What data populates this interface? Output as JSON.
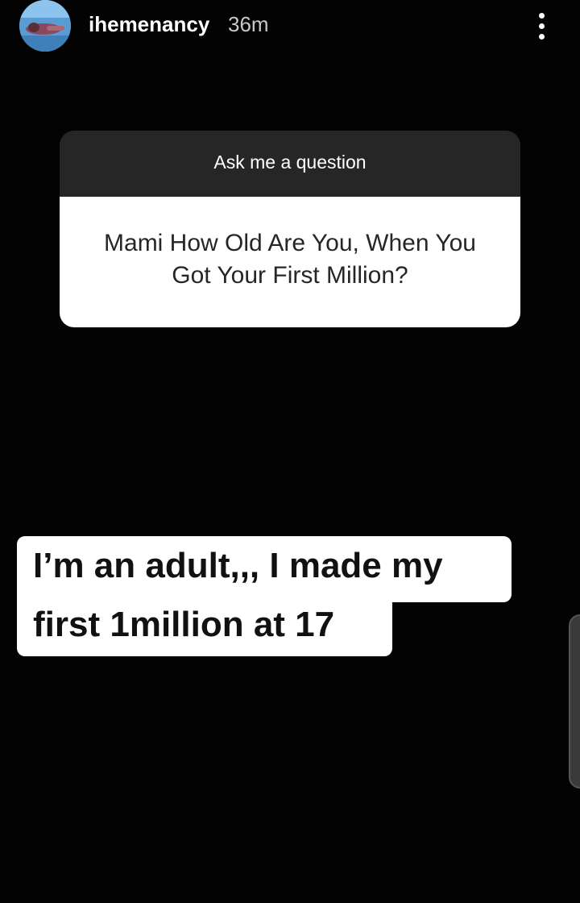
{
  "story": {
    "username": "ihemenancy",
    "time_ago": "36m",
    "more_icon": "more-vertical-icon"
  },
  "question_sticker": {
    "header": "Ask me a question",
    "question": "Mami How Old Are You, When You Got Your First Million?"
  },
  "answer": {
    "line1": "I’m an adult,,, I made my",
    "line2": "first 1million at 17"
  },
  "colors": {
    "background": "#030303",
    "sticker_header": "#262626",
    "sticker_body": "#ffffff",
    "text_dark": "#111111"
  }
}
